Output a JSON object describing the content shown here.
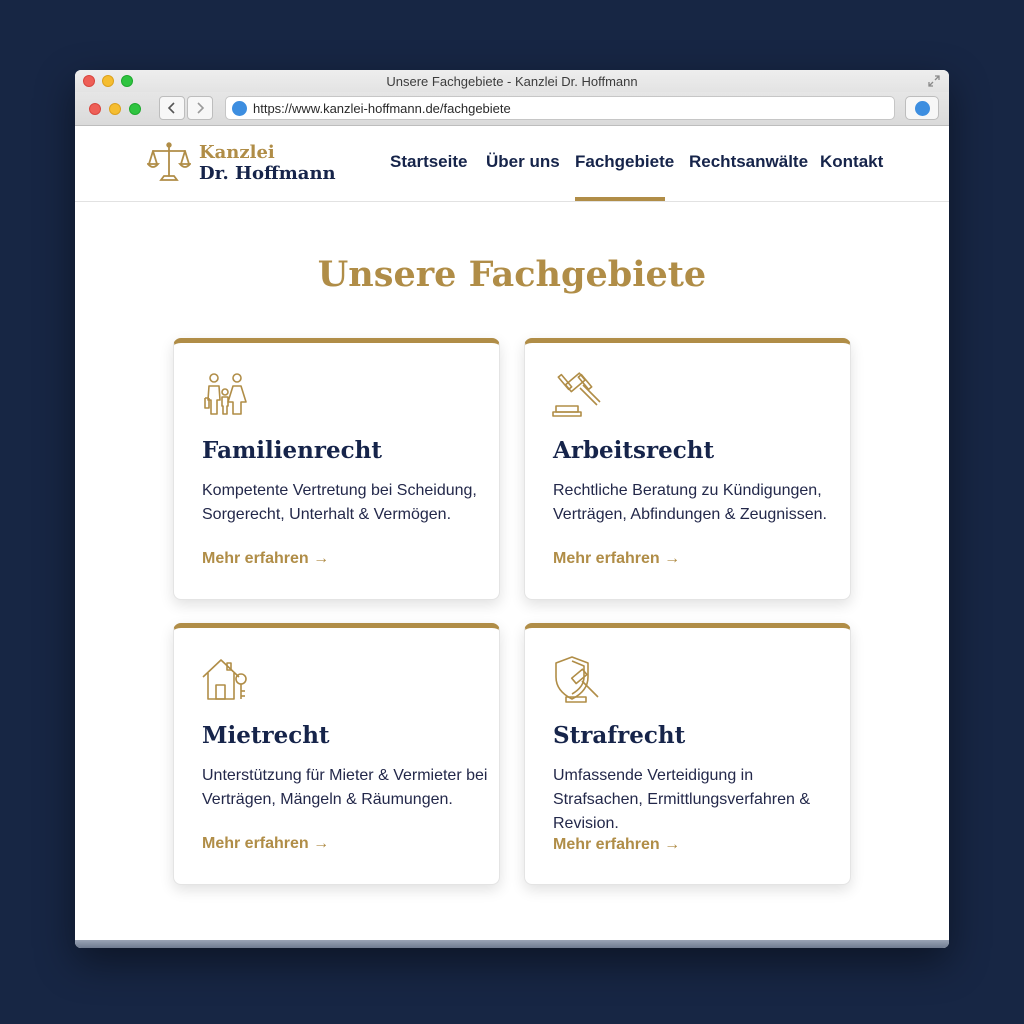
{
  "browser": {
    "window_title": "Unsere Fachgebiete - Kanzlei Dr. Hoffmann",
    "url": "https://www.kanzlei-hoffmann.de/fachgebiete",
    "back_icon": "chevron-left-icon",
    "forward_icon": "chevron-right-icon"
  },
  "logo": {
    "line1": "Kanzlei",
    "line2": "Dr. Hoffmann",
    "icon": "scales-of-justice-icon"
  },
  "nav": {
    "items": [
      {
        "label": "Startseite",
        "active": false
      },
      {
        "label": "Über uns",
        "active": false
      },
      {
        "label": "Fachgebiete",
        "active": true
      },
      {
        "label": "Rechtsanwälte",
        "active": false
      },
      {
        "label": "Kontakt",
        "active": false
      }
    ]
  },
  "page": {
    "title": "Unsere Fachgebiete"
  },
  "cards": [
    {
      "icon": "family-icon",
      "title": "Familienrecht",
      "description": "Kompetente Vertretung bei Scheidung, Sorgerecht, Unterhalt & Vermögen.",
      "link": "Mehr erfahren →"
    },
    {
      "icon": "gavel-icon",
      "title": "Arbeitsrecht",
      "description": "Rechtliche Beratung zu Kündigungen, Verträgen, Abfindungen & Zeugnissen.",
      "link": "Mehr erfahren →"
    },
    {
      "icon": "house-key-icon",
      "title": "Mietrecht",
      "description": "Unterstützung für Mieter & Vermieter bei Verträgen, Mängeln & Räumungen.",
      "link": "Mehr erfahren →"
    },
    {
      "icon": "shield-gavel-icon",
      "title": "Strafrecht",
      "description": "Umfassende Verteidigung in Strafsachen, Ermittlungsverfahren & Revision.",
      "link": "Mehr erfahren →"
    }
  ],
  "colors": {
    "background": "#172644",
    "accent_gold": "#b08d47",
    "navy": "#16244a"
  }
}
